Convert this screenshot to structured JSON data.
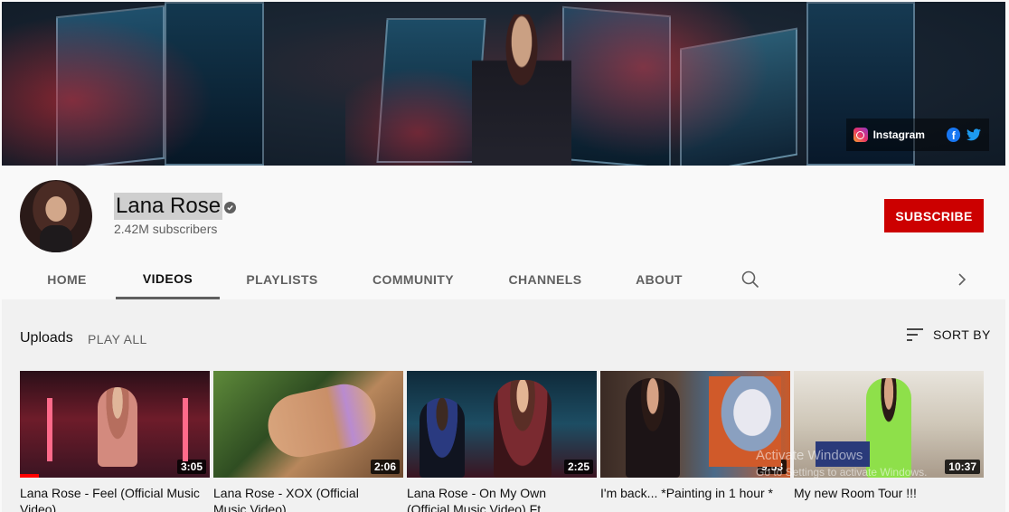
{
  "banner": {
    "social": {
      "label": "Instagram"
    }
  },
  "channel": {
    "name": "Lana Rose",
    "subscribers": "2.42M subscribers",
    "subscribe_label": "SUBSCRIBE"
  },
  "tabs": [
    {
      "label": "HOME"
    },
    {
      "label": "VIDEOS"
    },
    {
      "label": "PLAYLISTS"
    },
    {
      "label": "COMMUNITY"
    },
    {
      "label": "CHANNELS"
    },
    {
      "label": "ABOUT"
    }
  ],
  "uploads": {
    "title": "Uploads",
    "play_all": "PLAY ALL",
    "sort_label": "SORT BY"
  },
  "videos": [
    {
      "title": "Lana Rose - Feel (Official Music Video)",
      "duration": "3:05",
      "watched_fraction": 0.1
    },
    {
      "title": "Lana Rose - XOX (Official Music Video)",
      "duration": "2:06"
    },
    {
      "title": "Lana Rose - On My Own (Official Music Video) Ft.",
      "duration": "2:25"
    },
    {
      "title": "I'm back... *Painting in 1 hour *",
      "duration": "9:53"
    },
    {
      "title": "My new Room Tour !!!",
      "duration": "10:37"
    }
  ],
  "overlay": {
    "line1": "Activate Windows",
    "line2": "Go to Settings to activate Windows."
  },
  "colors": {
    "subscribe": "#cc0000",
    "progress": "#ff0000",
    "facebook": "#1877f2",
    "twitter": "#1d9bf0"
  }
}
